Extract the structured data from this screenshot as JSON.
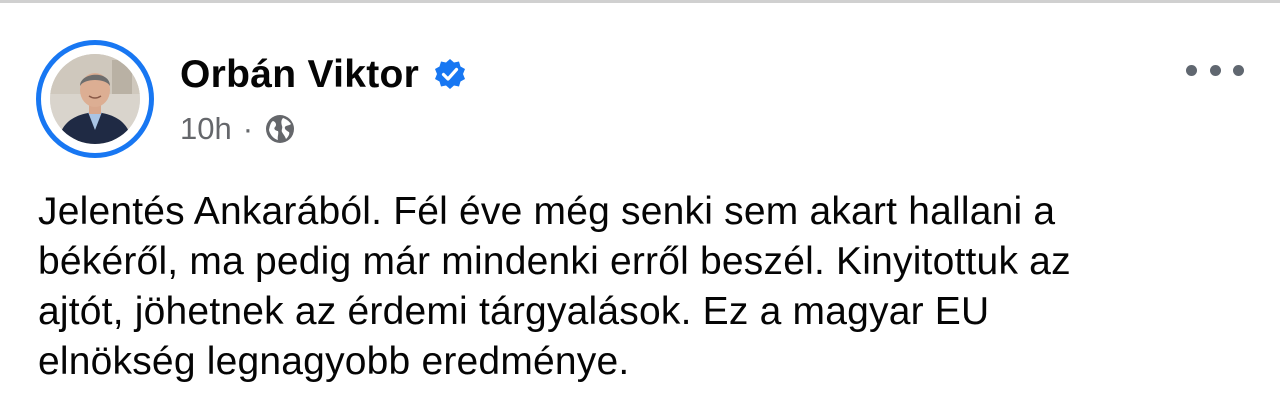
{
  "post": {
    "author": "Orbán Viktor",
    "verified": true,
    "timestamp": "10h",
    "separator": "·",
    "audience_icon": "globe-icon",
    "more_icon": "more-options-icon",
    "text_lines": [
      "Jelentés Ankarából. Fél éve még senki sem akart hallani a",
      "békéről, ma pedig már mindenki erről beszél. Kinyitottuk az",
      "ajtót, jöhetnek az érdemi tárgyalások. Ez a magyar EU",
      "elnökség legnagyobb eredménye."
    ]
  },
  "colors": {
    "verified_badge": "#1877f2",
    "avatar_ring": "#1877f2",
    "meta_text": "#65676b",
    "body_text": "#050505"
  }
}
